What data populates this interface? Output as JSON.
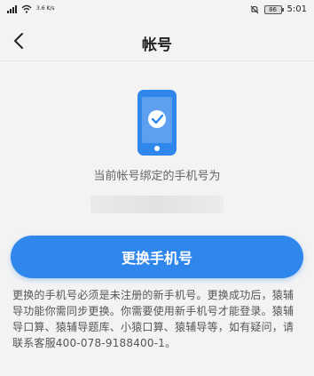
{
  "status": {
    "net_speed": "3.6\nK/s",
    "battery": "86",
    "time": "5:01"
  },
  "nav": {
    "title": "帐号"
  },
  "main": {
    "prompt": "当前帐号绑定的手机号为",
    "phone_masked": "",
    "button_label": "更换手机号",
    "notice": "更换的手机号必须是未注册的新手机号。更换成功后，猿辅导功能你需同步更换。你需要使用新手机号才能登录。猿辅导口算、猿辅导题库、小猿口算、猿辅导等，如有疑问，请联系客服400-078-9188400-1。"
  },
  "colors": {
    "accent": "#2f86eb",
    "background": "#f3f3f3"
  }
}
